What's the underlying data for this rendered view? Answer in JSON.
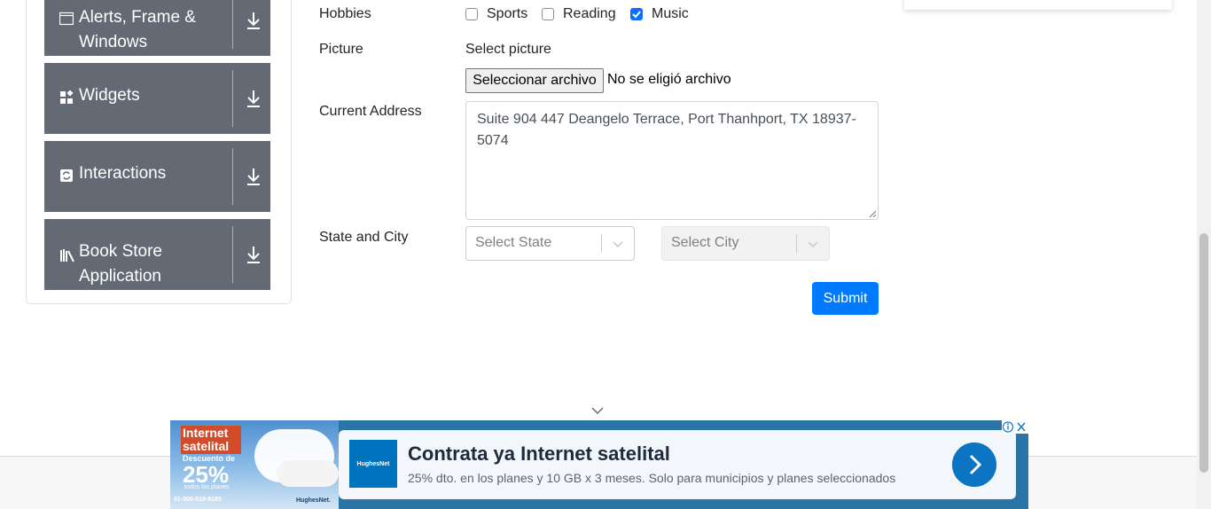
{
  "sidebar": {
    "groups": [
      {
        "label": "Alerts, Frame & Windows",
        "icon": "window-icon"
      },
      {
        "label": "Widgets",
        "icon": "widgets-icon"
      },
      {
        "label": "Interactions",
        "icon": "interactions-icon"
      },
      {
        "label": "Book Store Application",
        "icon": "books-icon"
      }
    ]
  },
  "form": {
    "hobbies_label": "Hobbies",
    "hobbies": [
      {
        "label": "Sports",
        "checked": false
      },
      {
        "label": "Reading",
        "checked": false
      },
      {
        "label": "Music",
        "checked": true
      }
    ],
    "picture_label": "Picture",
    "picture_hint": "Select picture",
    "file_button": "Seleccionar archivo",
    "file_status": "No se eligió archivo",
    "address_label": "Current Address",
    "address_value": "Suite 904 447 Deangelo Terrace, Port Thanhport, TX 18937-5074",
    "state_city_label": "State and City",
    "state_placeholder": "Select State",
    "city_placeholder": "Select City",
    "submit_label": "Submit"
  },
  "ad": {
    "image_title": "Internet satelital",
    "image_discount_label": "Descuento de",
    "image_discount": "25%",
    "image_small": "todos los planes",
    "image_phone": "01-800-518-9185",
    "image_brand": "HughesNet.",
    "logo_text": "HughesNet",
    "title": "Contrata ya Internet satelital",
    "description": "25% dto. en los planes y 10 GB x 3 meses. Solo para municipios y planes seleccionados"
  },
  "colors": {
    "sidebar_group_bg": "#646a73",
    "primary": "#007bff",
    "checkbox_checked": "#0d6efd"
  }
}
